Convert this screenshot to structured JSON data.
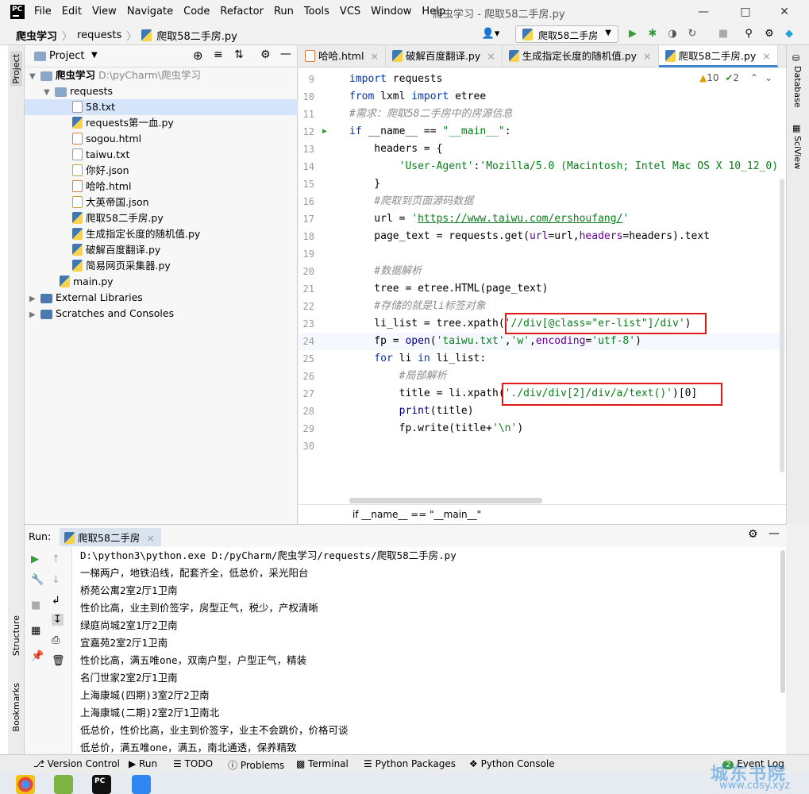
{
  "window": {
    "title": "爬虫学习 - 爬取58二手房.py"
  },
  "menu": [
    "File",
    "Edit",
    "View",
    "Navigate",
    "Code",
    "Refactor",
    "Run",
    "Tools",
    "VCS",
    "Window",
    "Help"
  ],
  "breadcrumb": [
    "爬虫学习",
    "requests",
    "爬取58二手房.py"
  ],
  "run_config": "爬取58二手房",
  "project": {
    "header": "Project",
    "root_name": "爬虫学习",
    "root_path": "D:\\pyCharm\\爬虫学习",
    "items": [
      {
        "name": "requests",
        "kind": "folder"
      },
      {
        "name": "58.txt",
        "kind": "txt"
      },
      {
        "name": "requests第一血.py",
        "kind": "py"
      },
      {
        "name": "sogou.html",
        "kind": "html"
      },
      {
        "name": "taiwu.txt",
        "kind": "txt"
      },
      {
        "name": "你好.json",
        "kind": "json"
      },
      {
        "name": "哈哈.html",
        "kind": "html"
      },
      {
        "name": "大英帝国.json",
        "kind": "json"
      },
      {
        "name": "爬取58二手房.py",
        "kind": "py"
      },
      {
        "name": "生成指定长度的随机值.py",
        "kind": "py"
      },
      {
        "name": "破解百度翻译.py",
        "kind": "py"
      },
      {
        "name": "简易网页采集器.py",
        "kind": "py"
      },
      {
        "name": "main.py",
        "kind": "py"
      },
      {
        "name": "External Libraries",
        "kind": "lib"
      },
      {
        "name": "Scratches and Consoles",
        "kind": "lib"
      }
    ]
  },
  "tabs": [
    "哈哈.html",
    "破解百度翻译.py",
    "生成指定长度的随机值.py",
    "爬取58二手房.py"
  ],
  "inspections": {
    "warnings": "10",
    "ok": "2"
  },
  "editor_breadcrumb": "if __name__ == \"__main__\"",
  "side_labels": {
    "project": "Project",
    "database": "Database",
    "sciview": "SciView",
    "structure": "Structure",
    "bookmarks": "Bookmarks"
  },
  "code_lines": [
    "9",
    "10",
    "11",
    "12",
    "13",
    "14",
    "15",
    "16",
    "17",
    "18",
    "19",
    "20",
    "21",
    "22",
    "23",
    "24",
    "25",
    "26",
    "27",
    "28",
    "29",
    "30"
  ],
  "run": {
    "label": "Run:",
    "config": "爬取58二手房",
    "output": [
      "D:\\python3\\python.exe D:/pyCharm/爬虫学习/requests/爬取58二手房.py",
      "一梯两户，地铁沿线，配套齐全，低总价，采光阳台",
      "桥苑公寓2室2厅1卫南",
      "性价比高，业主到价签字，房型正气，税少，产权清晰",
      "绿庭尚城2室1厅2卫南",
      "宜嘉苑2室2厅1卫南",
      "性价比高，满五唯one，双南户型，户型正气，精装",
      "名门世家2室2厅1卫南",
      "上海康城(四期)3室2厅2卫南",
      "上海康城(二期)2室2厅1卫南北",
      "低总价，性价比高，业主到价签字，业主不会跳价，价格可谈",
      "低总价，满五唯one，满五，南北通透，保养精致"
    ]
  },
  "bottom": {
    "version_control": "Version Control",
    "run": "Run",
    "todo": "TODO",
    "problems": "Problems",
    "terminal": "Terminal",
    "python_packages": "Python Packages",
    "python_console": "Python Console",
    "event_log": "Event Log",
    "event_count": "2"
  },
  "watermark": {
    "title": "城东书院",
    "url": "www.cdsy.xyz"
  }
}
